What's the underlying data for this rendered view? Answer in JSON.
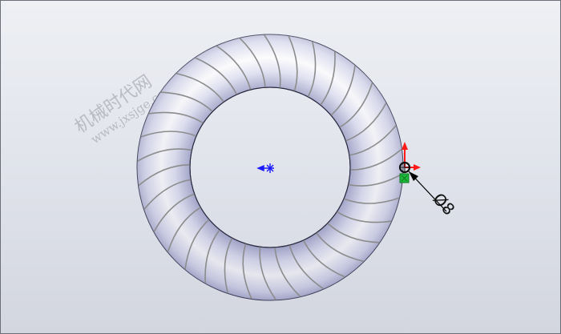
{
  "watermark": {
    "line1": "机械时代网",
    "line2": "www.jxsjge.com"
  },
  "dimension": {
    "symbol": "Ø",
    "value": "8"
  },
  "colors": {
    "background_top": "#eef0f4",
    "background_bottom": "#d3d6df",
    "torus_light": "#ffffff",
    "torus_shade": "#9ea0c4",
    "coil": "#8c8c8c",
    "origin": "#1a1aff",
    "triad_x": "#ff1a1a",
    "triad_y": "#ff1a1a",
    "triad_z": "#1fb83a",
    "leader": "#000000"
  },
  "icons": {
    "center_origin": "origin-marker-icon",
    "triad": "coordinate-triad-icon"
  }
}
